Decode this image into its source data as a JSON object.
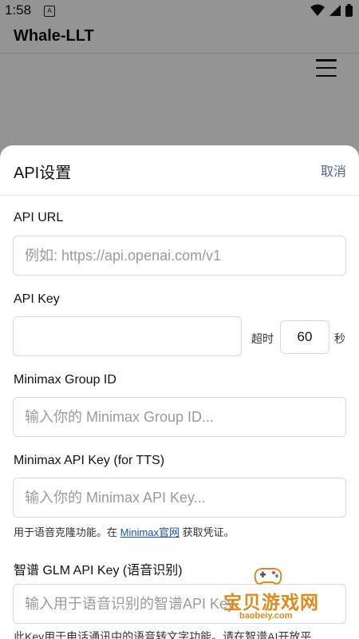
{
  "status": {
    "time": "1:58",
    "badge": "A"
  },
  "app": {
    "title": "Whale-LLT"
  },
  "sheet": {
    "title": "API设置",
    "cancel": "取消",
    "api_url": {
      "label": "API URL",
      "placeholder": "例如: https://api.openai.com/v1",
      "value": ""
    },
    "api_key": {
      "label": "API Key",
      "value": "",
      "timeout_label": "超时",
      "timeout_value": "60",
      "timeout_unit": "秒"
    },
    "minimax_group": {
      "label": "Minimax Group ID",
      "placeholder": "输入你的 Minimax Group ID..."
    },
    "minimax_api": {
      "label": "Minimax API Key (for TTS)",
      "placeholder": "输入你的 Minimax API Key...",
      "help_prefix": "用于语音克隆功能。在 ",
      "help_link": "Minimax官网",
      "help_suffix": " 获取凭证。"
    },
    "glm": {
      "label": "智谱 GLM API Key (语音识别)",
      "placeholder": "输入用于语音识别的智谱API Key",
      "help_cut": "此Key用于电话通讯中的语音转文字功能。请在智谱AI开放平"
    }
  },
  "watermark": {
    "text": "宝贝游戏网",
    "sub": "baobeiy.com"
  }
}
